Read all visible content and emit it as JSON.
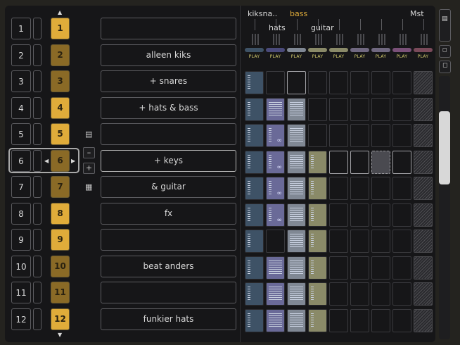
{
  "scenes": [
    {
      "num": "1",
      "name": "",
      "color": "bright"
    },
    {
      "num": "2",
      "name": "alleen kiks",
      "color": "dark"
    },
    {
      "num": "3",
      "name": "+ snares",
      "color": "dark"
    },
    {
      "num": "4",
      "name": "+ hats & bass",
      "color": "bright"
    },
    {
      "num": "5",
      "name": "",
      "color": "bright"
    },
    {
      "num": "6",
      "name": "+ keys",
      "color": "dark"
    },
    {
      "num": "7",
      "name": "& guitar",
      "color": "dark"
    },
    {
      "num": "8",
      "name": "fx",
      "color": "bright"
    },
    {
      "num": "9",
      "name": "",
      "color": "bright"
    },
    {
      "num": "10",
      "name": "beat anders",
      "color": "dark"
    },
    {
      "num": "11",
      "name": "",
      "color": "dark"
    },
    {
      "num": "12",
      "name": "funkier hats",
      "color": "bright"
    }
  ],
  "selected_scene": "6",
  "side_buttons": {
    "minus": "–",
    "plus": "+"
  },
  "tracks": [
    {
      "label": "kiksna..",
      "color": "#3e5266",
      "active": false
    },
    {
      "label": "hats",
      "color": "#4a4a7a",
      "active": false
    },
    {
      "label": "bass",
      "color": "#808894",
      "active": true
    },
    {
      "label": "guitar",
      "color": "#8a8a68",
      "active": false
    },
    {
      "label": "",
      "color": "#8a8a68",
      "active": false
    },
    {
      "label": "",
      "color": "#706880",
      "active": false
    },
    {
      "label": "",
      "color": "#706880",
      "active": false
    },
    {
      "label": "",
      "color": "#7a5078",
      "active": false
    },
    {
      "label": "Mst",
      "color": "#7a4a5a",
      "active": false
    }
  ],
  "play_label": "PLAY",
  "colors": {
    "accent": "#e0ac3a"
  }
}
